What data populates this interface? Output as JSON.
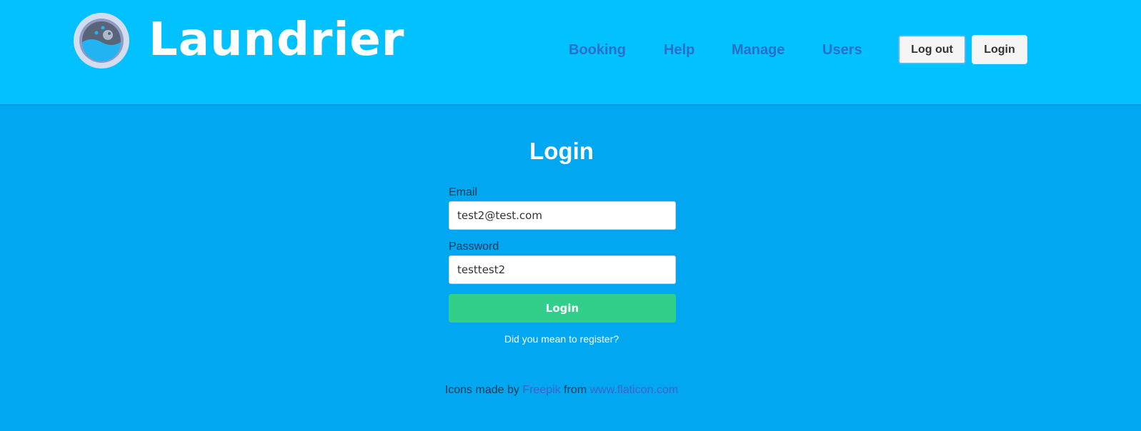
{
  "header": {
    "brand": "Laundrier",
    "nav": [
      "Booking",
      "Help",
      "Manage",
      "Users"
    ],
    "logout_label": "Log out",
    "login_label": "Login"
  },
  "form": {
    "title": "Login",
    "email_label": "Email",
    "email_value": "test2@test.com",
    "password_label": "Password",
    "password_value": "testtest2",
    "submit_label": "Login",
    "register_link": "Did you mean to register?"
  },
  "footer": {
    "prefix": "Icons made by",
    "author": "Freepik",
    "middle": "from",
    "site": "www.flaticon.com"
  },
  "colors": {
    "header_bg": "#02c1ff",
    "page_bg": "#01a7f0",
    "nav_link": "#2a6fc9",
    "submit_bg": "#31cf89",
    "footer_link": "#3f63c9"
  },
  "icons": {
    "logo": "washing-machine-icon"
  }
}
